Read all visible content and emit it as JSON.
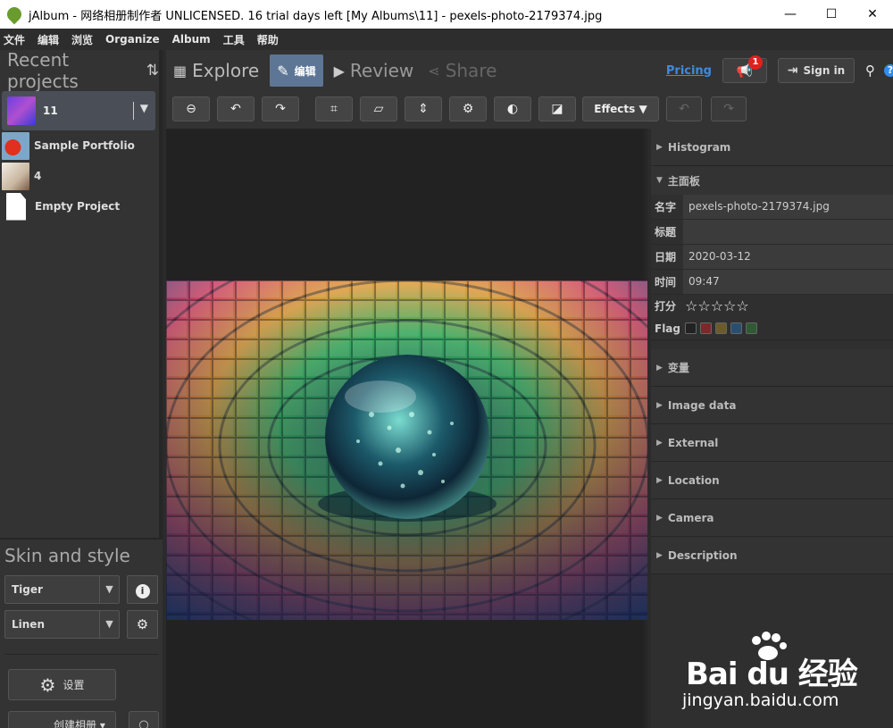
{
  "window": {
    "title": "jAlbum - 网络相册制作者 UNLICENSED. 16 trial days left [My Albums\\11] - pexels-photo-2179374.jpg",
    "minimize": "—",
    "maximize": "☐",
    "close": "✕"
  },
  "menu": [
    "文件",
    "编辑",
    "浏览",
    "Organize",
    "Album",
    "工具",
    "帮助"
  ],
  "left": {
    "recent_projects_label": "Recent projects",
    "sort_glyph": "⇅",
    "current_project": "11",
    "projects": [
      "Sample Portfolio",
      "4",
      "Empty Project"
    ],
    "skin_and_style_label": "Skin and style",
    "skin": "Tiger",
    "style": "Linen",
    "settings_label": "设置",
    "make_album_label": "创建相册"
  },
  "tabs": {
    "explore": "Explore",
    "edit": "编辑",
    "review": "Review",
    "share": "Share"
  },
  "header": {
    "pricing": "Pricing",
    "notifications_count": "1",
    "sign_in": "Sign in"
  },
  "toolbar": {
    "effects": "Effects"
  },
  "right": {
    "histogram": "Histogram",
    "main_panel": "主面板",
    "props": {
      "name_label": "名字",
      "name": "pexels-photo-2179374.jpg",
      "title_label": "标题",
      "title": "",
      "date_label": "日期",
      "date": "2020-03-12",
      "time_label": "时间",
      "time": "09:47",
      "rating_label": "打分",
      "rating": "☆☆☆☆☆",
      "flag_label": "Flag"
    },
    "flag_colors": [
      "#222222",
      "#7a2a2a",
      "#6b5a2a",
      "#2a4f6e",
      "#2f5a34"
    ],
    "sections": [
      "变量",
      "Image data",
      "External",
      "Location",
      "Camera",
      "Description"
    ]
  },
  "watermark": {
    "logo": "Bai du 经验",
    "url": "jingyan.baidu.com"
  }
}
